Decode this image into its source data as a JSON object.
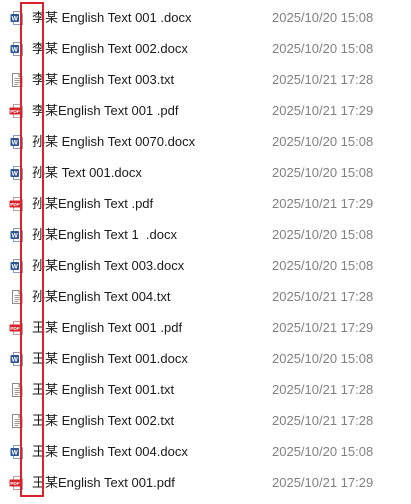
{
  "files": [
    {
      "name": "李某 English Text 001 .docx",
      "date": "2025/10/20 15:08",
      "type": "docx"
    },
    {
      "name": "李某 English Text 002.docx",
      "date": "2025/10/20 15:08",
      "type": "docx"
    },
    {
      "name": "李某 English Text 003.txt",
      "date": "2025/10/21 17:28",
      "type": "txt"
    },
    {
      "name": "李某English Text 001 .pdf",
      "date": "2025/10/21 17:29",
      "type": "pdf"
    },
    {
      "name": "孙某 English Text 0070.docx",
      "date": "2025/10/20 15:08",
      "type": "docx"
    },
    {
      "name": "孙某 Text 001.docx",
      "date": "2025/10/20 15:08",
      "type": "docx"
    },
    {
      "name": "孙某English Text .pdf",
      "date": "2025/10/21 17:29",
      "type": "pdf"
    },
    {
      "name": "孙某English Text 1  .docx",
      "date": "2025/10/20 15:08",
      "type": "docx"
    },
    {
      "name": "孙某English Text 003.docx",
      "date": "2025/10/20 15:08",
      "type": "docx"
    },
    {
      "name": "孙某English Text 004.txt",
      "date": "2025/10/21 17:28",
      "type": "txt"
    },
    {
      "name": "王某 English Text 001 .pdf",
      "date": "2025/10/21 17:29",
      "type": "pdf"
    },
    {
      "name": "王某 English Text 001.docx",
      "date": "2025/10/20 15:08",
      "type": "docx"
    },
    {
      "name": "王某 English Text 001.txt",
      "date": "2025/10/21 17:28",
      "type": "txt"
    },
    {
      "name": "王某 English Text 002.txt",
      "date": "2025/10/21 17:28",
      "type": "txt"
    },
    {
      "name": "王某 English Text 004.docx",
      "date": "2025/10/20 15:08",
      "type": "docx"
    },
    {
      "name": "王某English Text 001.pdf",
      "date": "2025/10/21 17:29",
      "type": "pdf"
    }
  ],
  "icons": {
    "docx": "word-document-icon",
    "txt": "text-file-icon",
    "pdf": "pdf-file-icon"
  },
  "colors": {
    "highlight": "#d9232a",
    "word_blue": "#2b5797",
    "pdf_red": "#d9232a",
    "date_gray": "#808080"
  },
  "icon_labels": {
    "docx": "W",
    "pdf": "PDF"
  }
}
